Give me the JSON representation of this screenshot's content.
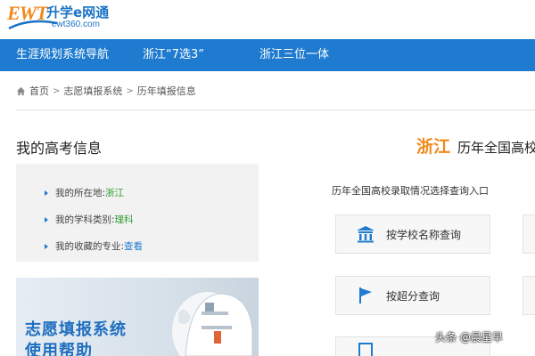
{
  "logo": {
    "brand": "EWT",
    "name": "升学e网通",
    "url": "ewt360.com"
  },
  "nav": {
    "items": [
      {
        "label": "生涯规划系统导航"
      },
      {
        "label": "浙江“7选3”"
      },
      {
        "label": "浙江三位一体"
      }
    ],
    "background": "#1f7bd0"
  },
  "breadcrumb": {
    "home": "首页",
    "level1": "志愿填报系统",
    "level2": "历年填报信息"
  },
  "exam_info": {
    "title": "我的高考信息",
    "location_label": "我的所在地:",
    "location_value": "浙江",
    "subject_label": "我的学科类别:",
    "subject_value": "理科",
    "favorite_label": "我的收藏的专业:",
    "favorite_link": "查看"
  },
  "help_banner": {
    "line1": "志愿填报系统",
    "line2": "使用帮助"
  },
  "right": {
    "province": "浙江",
    "title": "历年全国高校",
    "entry_text": "历年全国高校录取情况选择查询入口",
    "buttons": [
      {
        "label": "按学校名称查询",
        "icon": "university-icon"
      },
      {
        "label": "按超分查询",
        "icon": "flag-icon"
      }
    ]
  },
  "watermark": "头条 @晨星早",
  "colors": {
    "accent_orange": "#f08a1c",
    "link_green": "#2e9e2e",
    "link_blue": "#1f7bd0"
  }
}
